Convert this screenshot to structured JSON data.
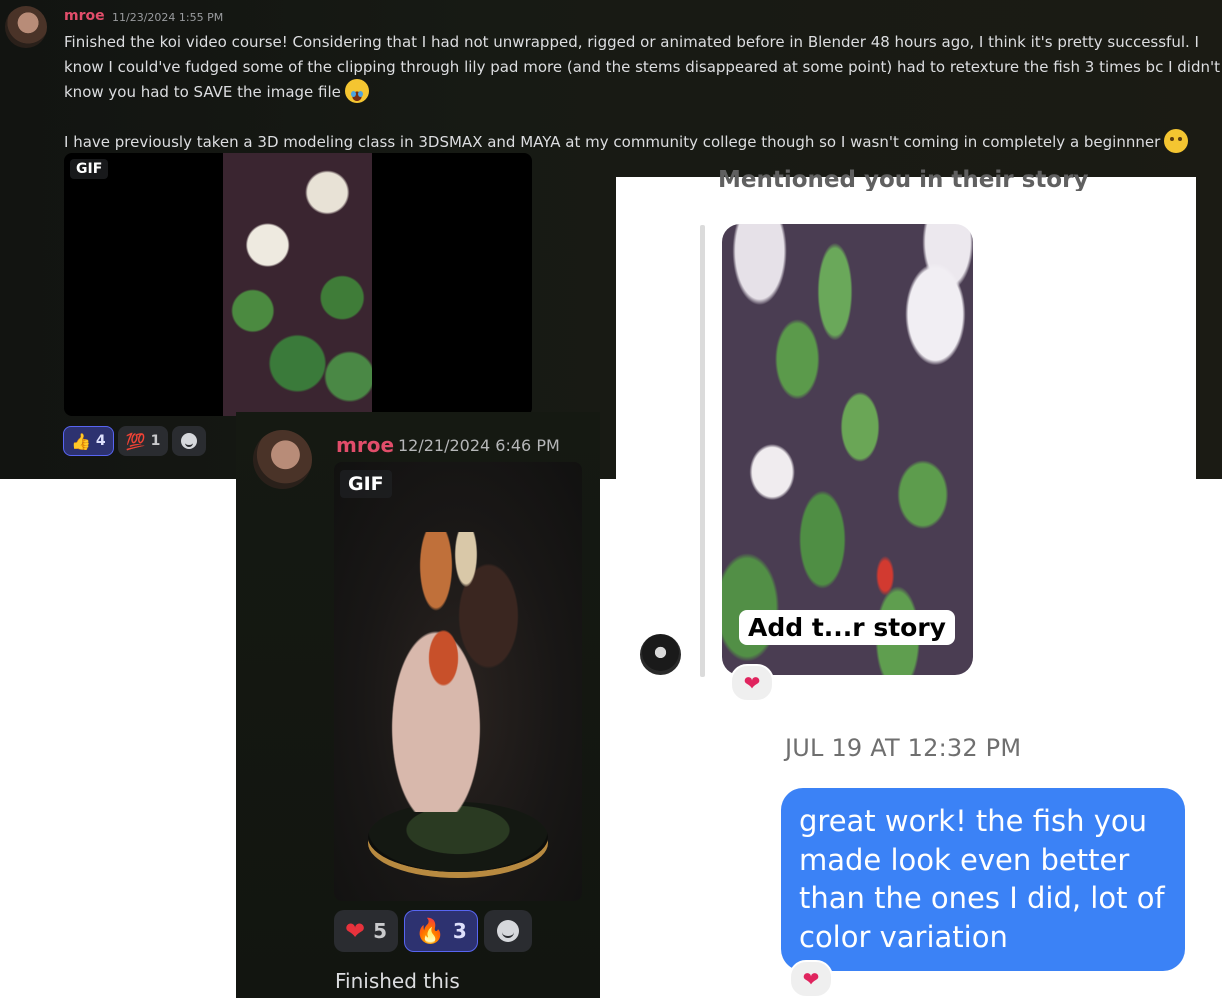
{
  "discord_post_1": {
    "username": "mroe",
    "timestamp": "11/23/2024 1:55 PM",
    "message_line_1": "Finished the koi video course! Considering that I had not unwrapped, rigged or animated before in Blender 48 hours ago, I think it's pretty successful. I know I could've fudged some of the clipping through lily pad more (and the stems disappeared at some point) had to retexture the fish 3 times bc I didn't know you had to SAVE the image file",
    "message_line_2": "I have previously taken a 3D modeling class in 3DSMAX and MAYA at my community college though so I wasn't coming in completely a beginnner",
    "gif_badge": "GIF",
    "reactions": [
      {
        "icon": "thumbs-up",
        "glyph": "👍",
        "count": "4",
        "active": true
      },
      {
        "icon": "hundred-points",
        "glyph": "💯",
        "count": "1",
        "active": false
      }
    ]
  },
  "instagram": {
    "heading": "Mentioned you in their story",
    "story_caption": "Add t...r story",
    "story_heart": "❤",
    "date_label": "JUL 19 AT 12:32 PM",
    "message": "great work! the fish you made look even better than the ones I did, lot of color variation",
    "message_heart": "❤"
  },
  "discord_post_2": {
    "username": "mroe",
    "timestamp": "12/21/2024 6:46 PM",
    "gif_badge": "GIF",
    "reactions": [
      {
        "icon": "heart",
        "glyph": "❤",
        "count": "5",
        "active": false
      },
      {
        "icon": "fire",
        "glyph": "🔥",
        "count": "3",
        "active": true
      }
    ],
    "caption": "Finished this"
  },
  "colors": {
    "discord_username": "#e14d6a",
    "discord_active_reaction": "#5865f2",
    "instagram_bubble": "#3b82f6"
  }
}
